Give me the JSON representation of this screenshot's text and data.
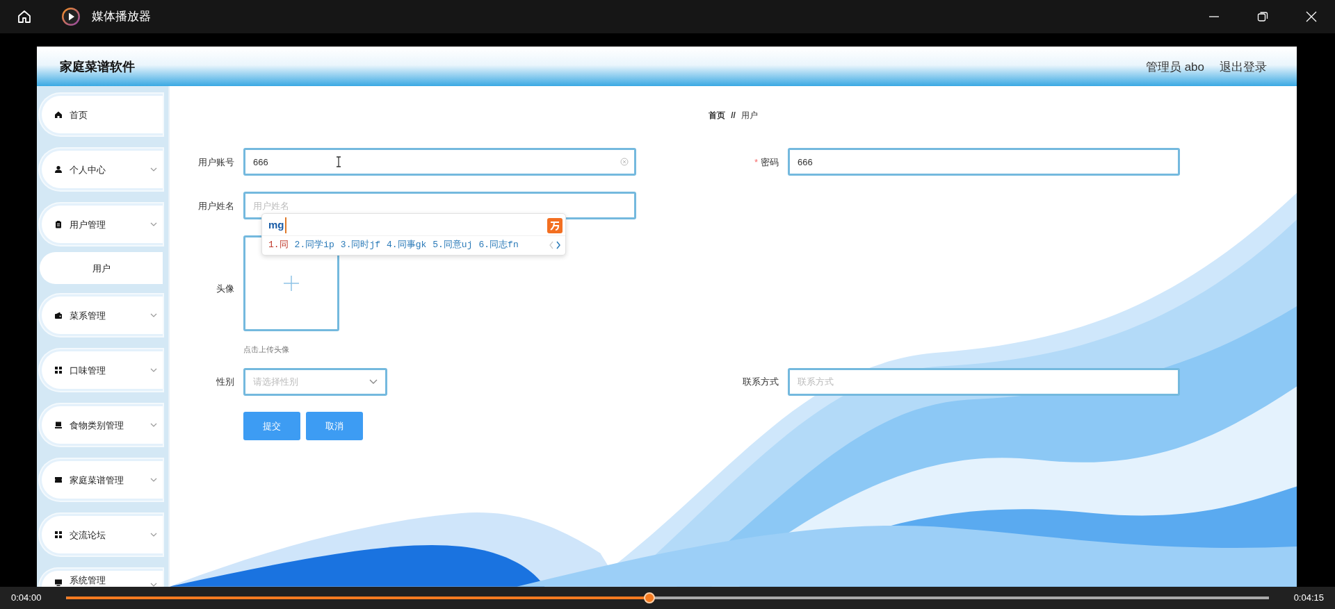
{
  "player": {
    "title": "媒体播放器",
    "time_current": "0:04:00",
    "time_total": "0:04:15",
    "level": 0.485
  },
  "app": {
    "title": "家庭菜谱软件",
    "user": "管理员 abo",
    "logout": "退出登录"
  },
  "sidebar": {
    "items": [
      {
        "label": "首页",
        "kind": "link"
      },
      {
        "label": "个人中心",
        "kind": "menu"
      },
      {
        "label": "用户管理",
        "kind": "menu",
        "children": [
          {
            "label": "用户"
          }
        ]
      },
      {
        "label": "菜系管理",
        "kind": "menu"
      },
      {
        "label": "口味管理",
        "kind": "menu"
      },
      {
        "label": "食物类别管理",
        "kind": "menu"
      },
      {
        "label": "家庭菜谱管理",
        "kind": "menu"
      },
      {
        "label": "交流论坛",
        "kind": "menu"
      },
      {
        "label": "系统管理",
        "kind": "menu"
      }
    ]
  },
  "breadcrumb": {
    "items": [
      "首页",
      "用户"
    ],
    "separator": "//"
  },
  "form": {
    "rows": [
      [
        {
          "label": "用户账号",
          "kind": "text",
          "value": "666",
          "clearable": true
        },
        {
          "label": "密码",
          "required_mark": "*",
          "kind": "text",
          "value": "666",
          "clearable": false
        }
      ],
      [
        {
          "label": "用户姓名",
          "kind": "text",
          "placeholder": "用户姓名",
          "clearable": false
        }
      ],
      [
        {
          "label": "头像",
          "kind": "upload",
          "hint": "点击上传头像"
        }
      ],
      [
        {
          "label": "性别",
          "kind": "select",
          "placeholder": "请选择性别"
        },
        {
          "label": "联系方式",
          "kind": "text",
          "placeholder": "联系方式",
          "clearable": false
        }
      ]
    ],
    "buttons": [
      "提交",
      "取消"
    ]
  },
  "ime": {
    "input": "mg",
    "candidates": [
      {
        "text": "1.同",
        "selected": true
      },
      {
        "text": "2.同学ip",
        "selected": false
      },
      {
        "text": "3.同时jf",
        "selected": false
      },
      {
        "text": "4.同事gk",
        "selected": false
      },
      {
        "text": "5.同意uj",
        "selected": false
      },
      {
        "text": "6.同志fn",
        "selected": false
      }
    ]
  }
}
